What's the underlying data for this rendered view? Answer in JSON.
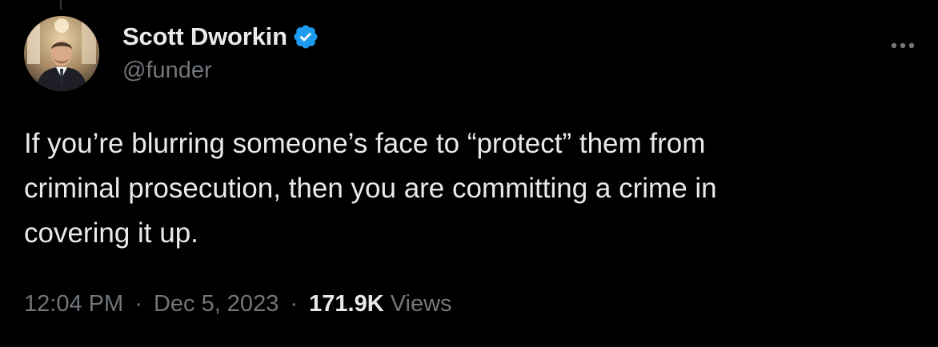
{
  "author": {
    "display_name": "Scott Dworkin",
    "handle": "@funder",
    "verified": true
  },
  "tweet": {
    "text_lines": [
      "If you’re blurring someone’s face to “protect” them from",
      "criminal prosecution, then you are committing a crime in",
      "covering it up."
    ],
    "time": "12:04 PM",
    "date": "Dec 5, 2023",
    "separator": "·",
    "views_count": "171.9K",
    "views_label": "Views"
  },
  "icons": {
    "verified": "verified-badge-icon",
    "more": "more-options-icon"
  },
  "colors": {
    "background": "#000000",
    "primary_text": "#e7e9ea",
    "secondary_text": "#71767b",
    "verified_blue": "#1d9bf0"
  }
}
